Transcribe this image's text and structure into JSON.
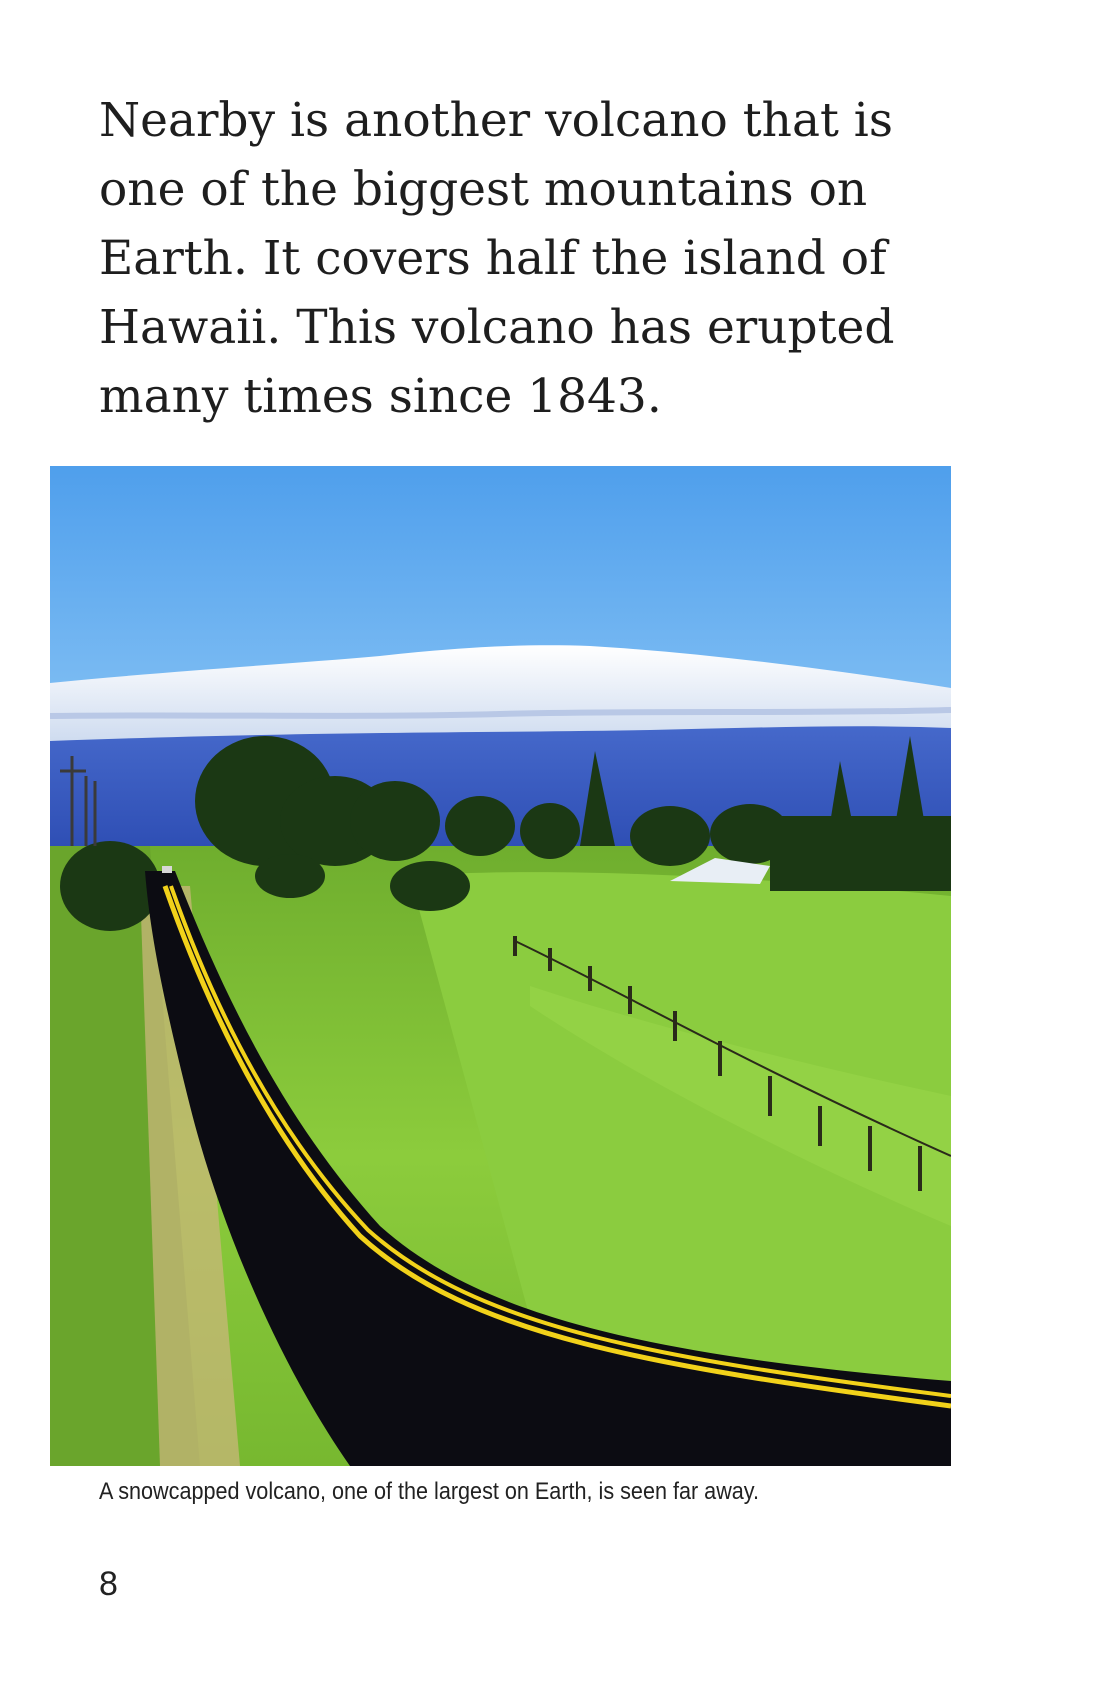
{
  "body_text_lines": [
    "Nearby is another volcano that is",
    "one of the biggest mountains on",
    "Earth. It covers half the island of",
    "Hawaii. This volcano has erupted",
    "many times since 1843."
  ],
  "photo": {
    "alt": "A snowcapped volcano, one of the largest on Earth, is seen far away.",
    "colors": {
      "sky_top": "#52a3ee",
      "sky_bottom": "#8cc6f5",
      "snow": "#f2f6fb",
      "mountain_shadow": "#3b5fc4",
      "grass": "#7fc23a",
      "grass_dark": "#3f7a1a",
      "trees": "#1c3a16",
      "road": "#0d0d12",
      "road_line": "#f2d21a"
    }
  },
  "caption": "A snowcapped volcano, one of the largest on Earth, is seen far away.",
  "page_number": "8"
}
